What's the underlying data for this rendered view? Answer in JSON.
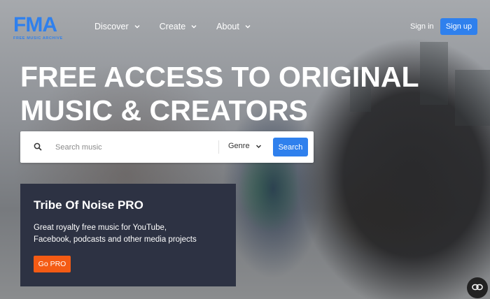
{
  "brand": {
    "logo_text": "FMA",
    "logo_subtitle": "FREE MUSIC ARCHIVE",
    "accent_color": "#2f80ed"
  },
  "nav": {
    "items": [
      {
        "label": "Discover",
        "icon": "chevron-down-icon"
      },
      {
        "label": "Create",
        "icon": "chevron-down-icon"
      },
      {
        "label": "About",
        "icon": "chevron-down-icon"
      }
    ],
    "signin_label": "Sign in",
    "signup_label": "Sign up"
  },
  "hero": {
    "headline_line1": "FREE ACCESS TO ORIGINAL",
    "headline_line2": "MUSIC & CREATORS"
  },
  "search": {
    "icon": "search-icon",
    "placeholder": "Search music",
    "genre_label": "Genre",
    "button_label": "Search"
  },
  "promo": {
    "title": "Tribe Of Noise PRO",
    "text": "Great royalty free music for YouTube, Facebook, podcasts and other media projects",
    "button_label": "Go PRO",
    "background_color": "#2d3243",
    "button_color": "#f45b14"
  },
  "floating_button": {
    "icon": "link-icon"
  }
}
